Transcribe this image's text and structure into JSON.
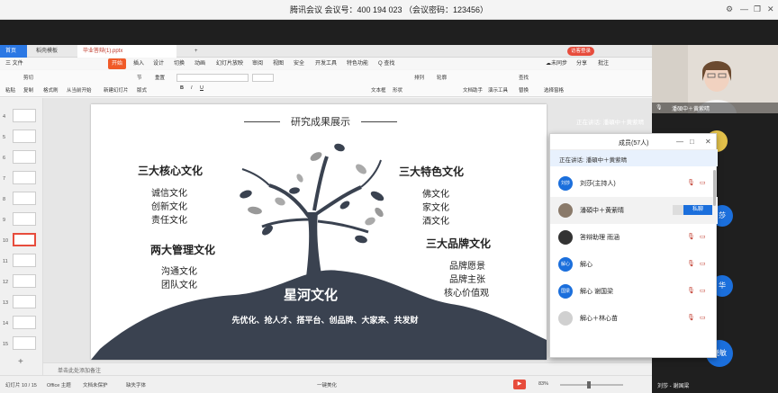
{
  "meeting": {
    "title": "腾讯会议 会议号：400 194 023 （会议密码：123456）",
    "window_controls": [
      "⚙",
      "—",
      "❐",
      "✕"
    ]
  },
  "wps": {
    "tabs": [
      "首页",
      "稻壳模板",
      "毕业答辩(1).pptx",
      "+"
    ],
    "right_badge": "访客登录",
    "menu": [
      "三 文件",
      "开始",
      "插入",
      "设计",
      "切换",
      "动画",
      "幻灯片放映",
      "审阅",
      "视图",
      "安全",
      "开发工具",
      "特色功能",
      "Q 查找"
    ],
    "share": [
      "☁未同步",
      "分享",
      "批注"
    ],
    "ribbon": [
      "粘贴",
      "剪切",
      "复制",
      "格式刷",
      "从当前开始",
      "新建幻灯片",
      "版式",
      "节",
      "重置",
      "文本框",
      "形状",
      "排列",
      "轮廓",
      "文档助手",
      "演示工具",
      "查找",
      "替换",
      "选择窗格"
    ],
    "status": [
      "幻灯片 10 / 15",
      "Office 主题",
      "文档未保护",
      "缺失字体",
      "一键美化",
      "83%"
    ],
    "notes_hint": "单击此处添加备注",
    "thumb_numbers": [
      "4",
      "5",
      "6",
      "7",
      "8",
      "9",
      "10",
      "11",
      "12",
      "13",
      "14",
      "15"
    ]
  },
  "slide": {
    "title": "研究成果展示",
    "left_sections": [
      {
        "heading": "三大核心文化",
        "items": [
          "诚信文化",
          "创新文化",
          "责任文化"
        ]
      },
      {
        "heading": "两大管理文化",
        "items": [
          "沟通文化",
          "团队文化"
        ]
      }
    ],
    "right_sections": [
      {
        "heading": "三大特色文化",
        "items": [
          "佛文化",
          "家文化",
          "酒文化"
        ]
      },
      {
        "heading": "三大品牌文化",
        "items": [
          "品牌愿景",
          "品牌主张",
          "核心价值观"
        ]
      }
    ],
    "center_title": "星河文化",
    "slogan": "先优化、抢人才、搭平台、创品牌、大家来、共发财"
  },
  "camera": {
    "caption": "潘碩中＋黄萦晴"
  },
  "members": {
    "title": "成员(57人)",
    "speaking": "正在讲话: 潘碩中＋黄萦晴",
    "list": [
      {
        "avatar": "刘莎",
        "name": "刘莎(主持人)",
        "color": "#1b6fdc"
      },
      {
        "avatar": "",
        "name": "潘碩中＋黄萦晴",
        "color": "#8a7a6a",
        "action": "私聊"
      },
      {
        "avatar": "",
        "name": "答辩助理 雨涵",
        "color": "#333333"
      },
      {
        "avatar": "解心",
        "name": "解心",
        "color": "#1b6fdc"
      },
      {
        "avatar": "国梁",
        "name": "解心 谢国梁",
        "color": "#1b6fdc"
      },
      {
        "avatar": "",
        "name": "解心＋林心苗",
        "color": "#d0d0d0"
      }
    ]
  },
  "right_panel": {
    "speaking": "正在讲话: 潘碩中＋黄萦晴",
    "avatars": [
      "莎",
      "华",
      "晓敏"
    ],
    "footer_name": "刘莎 - 谢国梁"
  },
  "colors": {
    "accent": "#1b6fdc",
    "active_thumb": "#e74c3c",
    "wps_orange": "#f05a28"
  }
}
